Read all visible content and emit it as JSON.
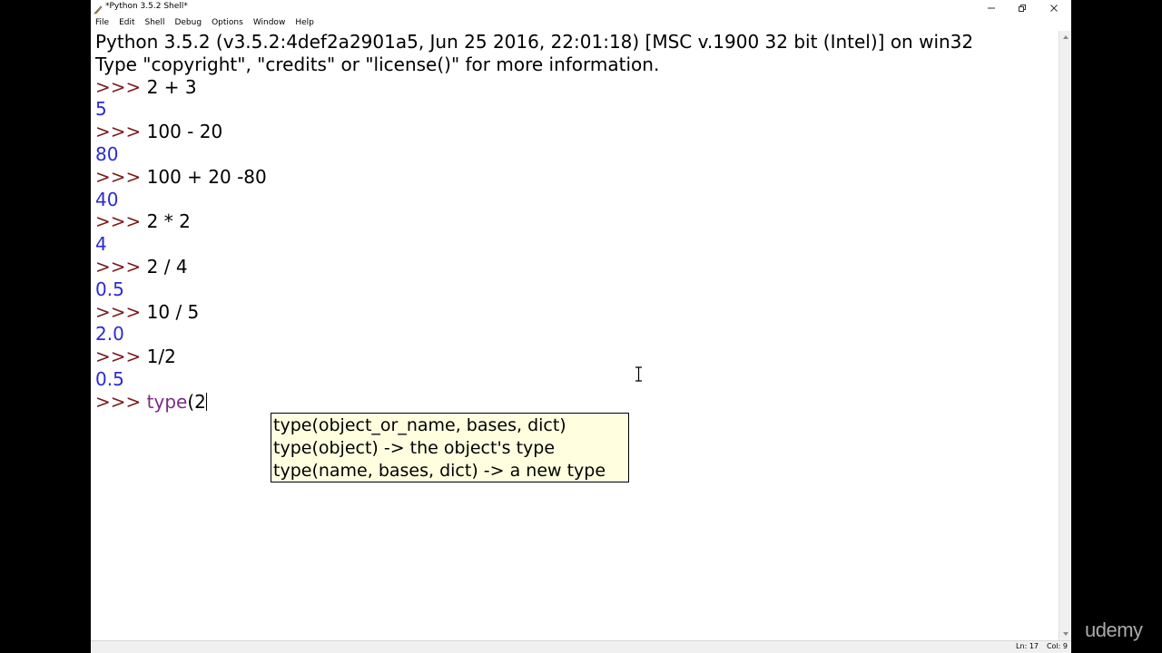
{
  "window": {
    "title": "*Python 3.5.2 Shell*",
    "icon": "python-feather-icon"
  },
  "menubar": {
    "items": [
      "File",
      "Edit",
      "Shell",
      "Debug",
      "Options",
      "Window",
      "Help"
    ]
  },
  "shell": {
    "banner_line1": "Python 3.5.2 (v3.5.2:4def2a2901a5, Jun 25 2016, 22:01:18) [MSC v.1900 32 bit (Intel)] on win32",
    "banner_line2": "Type \"copyright\", \"credits\" or \"license()\" for more information.",
    "prompt": ">>> ",
    "entries": [
      {
        "input": "2 + 3",
        "output": "5"
      },
      {
        "input": "100 - 20",
        "output": "80"
      },
      {
        "input": "100 + 20 -80",
        "output": "40"
      },
      {
        "input": "2 * 2",
        "output": "4"
      },
      {
        "input": "2 / 4",
        "output": "0.5"
      },
      {
        "input": "10 / 5",
        "output": "2.0"
      },
      {
        "input": "1/2",
        "output": "0.5"
      }
    ],
    "current_input_builtin": "type",
    "current_input_rest": "(2"
  },
  "calltip": {
    "lines": [
      "type(object_or_name, bases, dict)",
      "type(object) -> the object's type",
      "type(name, bases, dict) -> a new type"
    ]
  },
  "statusbar": {
    "line": "Ln: 17",
    "col": "Col: 9"
  },
  "watermark": "udemy",
  "colors": {
    "output": "#2b2bd6",
    "prompt": "#7a1a1a",
    "builtin": "#7a2a8a",
    "calltip_bg": "#ffffe0"
  }
}
